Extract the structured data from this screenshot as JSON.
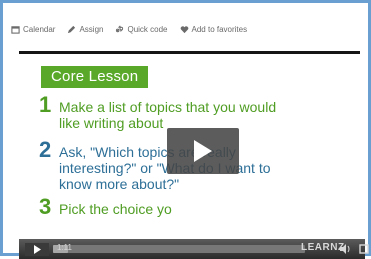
{
  "toolbar": {
    "items": [
      {
        "label": "Calendar",
        "icon": "calendar-icon"
      },
      {
        "label": "Assign",
        "icon": "pencil-icon"
      },
      {
        "label": "Quick code",
        "icon": "link-icon"
      },
      {
        "label": "Add to favorites",
        "icon": "heart-icon"
      }
    ]
  },
  "lesson": {
    "badge": "Core Lesson",
    "steps": [
      {
        "number": "1",
        "text": "Make a list of topics that you would\nlike writing about"
      },
      {
        "number": "2",
        "text": "Ask, \"Which topics are really\ninteresting?\" or \"What do I want to\nknow more about?\""
      },
      {
        "number": "3",
        "text": "Pick the choice yo"
      }
    ]
  },
  "player": {
    "time": "1:11",
    "brand": "LEARNZ",
    "progress": 0.06,
    "colors": {
      "badge": "#5aa82a",
      "step_green": "#4f9d23",
      "step_blue": "#2d6f97",
      "frame": "#6a9fd2"
    }
  }
}
